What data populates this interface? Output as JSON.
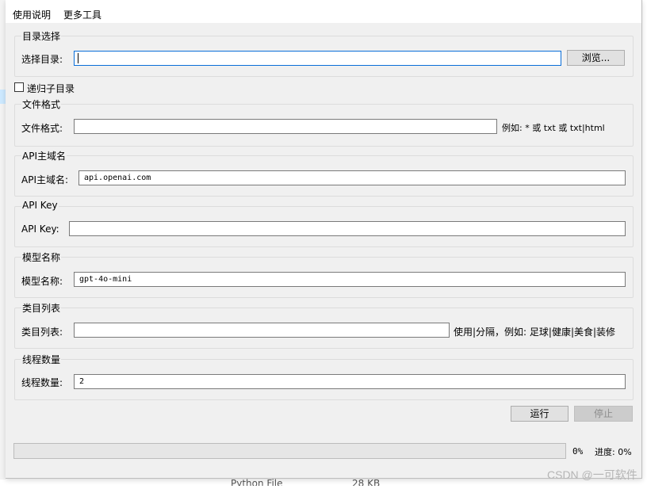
{
  "menu": {
    "items": [
      "使用说明",
      "更多工具"
    ]
  },
  "dir_group": {
    "title": "目录选择",
    "label": "选择目录:",
    "value": "",
    "browse_button": "浏览..."
  },
  "recursive_checkbox": {
    "label": "递归子目录",
    "checked": false
  },
  "format_group": {
    "title": "文件格式",
    "label": "文件格式:",
    "value": "",
    "hint": "例如: * 或 txt 或 txt|html"
  },
  "domain_group": {
    "title": "API主域名",
    "label": "API主域名:",
    "value": "api.openai.com"
  },
  "key_group": {
    "title": "API Key",
    "label": "API Key:",
    "value": ""
  },
  "model_group": {
    "title": "模型名称",
    "label": "模型名称:",
    "value": "gpt-4o-mini"
  },
  "category_group": {
    "title": "类目列表",
    "label": "类目列表:",
    "value": "",
    "hint": "使用|分隔，例如: 足球|健康|美食|装修"
  },
  "thread_group": {
    "title": "线程数量",
    "label": "线程数量:",
    "value": "2"
  },
  "actions": {
    "run_button": "运行",
    "stop_button": "停止"
  },
  "progress": {
    "fraction": 0,
    "percent_text": "0%",
    "status_text": "进度: 0%"
  },
  "background": {
    "file_type": "Python File",
    "file_size": "28 KB"
  },
  "watermark": "CSDN @一可软件",
  "colors": {
    "window_bg": "#f0f0f0",
    "focus_border": "#0a6ed8",
    "progress_fill": "#06b025"
  }
}
